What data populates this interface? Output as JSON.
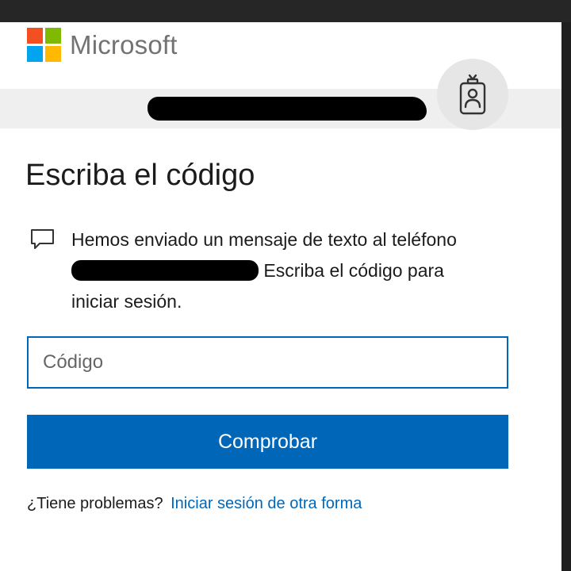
{
  "brand": {
    "name": "Microsoft",
    "colors": {
      "red": "#f25022",
      "green": "#7fba00",
      "blue": "#00a4ef",
      "yellow": "#ffb900",
      "text": "#737373"
    }
  },
  "account": {
    "identifier": "",
    "badge_icon": "id-badge-icon"
  },
  "page": {
    "title": "Escriba el código"
  },
  "message": {
    "icon": "chat-bubble-icon",
    "line_start": "Hemos enviado un mensaje de texto al teléfono",
    "line_end": " Escriba el código para iniciar sesión."
  },
  "code_input": {
    "placeholder": "Código",
    "value": ""
  },
  "verify_button": {
    "label": "Comprobar",
    "color": "#0067b8"
  },
  "help": {
    "prefix": "¿Tiene problemas?",
    "link": "Iniciar sesión de otra forma"
  }
}
